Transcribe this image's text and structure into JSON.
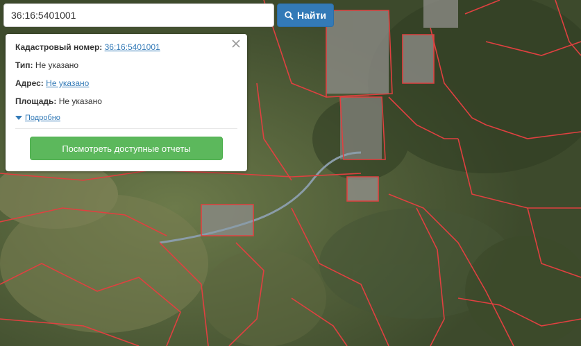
{
  "search": {
    "value": "36:16:5401001",
    "button_label": "Найти",
    "button_icon": "search-icon"
  },
  "popup": {
    "cadastral_label": "Кадастровый номер:",
    "cadastral_value": "36:16:5401001",
    "type_label": "Тип:",
    "type_value": "Не указано",
    "address_label": "Адрес:",
    "address_value": "Не указано",
    "area_label": "Площадь:",
    "area_value": "Не указано",
    "more_label": "Подробно",
    "report_button": "Посмотреть доступные отчеты"
  },
  "colors": {
    "parcel_border": "#e04040",
    "primary_button": "#337ab7",
    "success_button": "#5cb85c",
    "link": "#337ab7"
  }
}
